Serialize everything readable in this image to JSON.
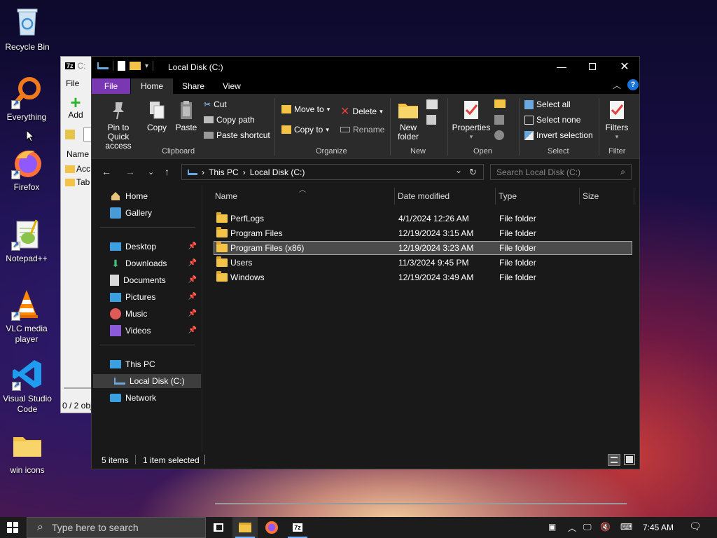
{
  "desktop": {
    "icons": [
      {
        "label": "Recycle Bin"
      },
      {
        "label": "Everything"
      },
      {
        "label": "Firefox"
      },
      {
        "label": "Notepad++"
      },
      {
        "label": "VLC media player"
      },
      {
        "label": "Visual Studio Code"
      },
      {
        "label": "win icons"
      }
    ]
  },
  "bg_window": {
    "title_fragment": "C:",
    "menu_fragment": "File",
    "add_label": "Add",
    "col_name": "Name",
    "rows": [
      "Acc",
      "Tab"
    ],
    "status": "0 / 2 obj"
  },
  "explorer": {
    "title": "Local Disk (C:)",
    "tabs": {
      "file": "File",
      "home": "Home",
      "share": "Share",
      "view": "View"
    },
    "ribbon": {
      "pin_label": "Pin to Quick access",
      "copy_label": "Copy",
      "paste_label": "Paste",
      "cut_label": "Cut",
      "copy_path_label": "Copy path",
      "paste_shortcut_label": "Paste shortcut",
      "clipboard_group": "Clipboard",
      "move_to_label": "Move to",
      "copy_to_label": "Copy to",
      "delete_label": "Delete",
      "rename_label": "Rename",
      "organize_group": "Organize",
      "new_folder_label": "New folder",
      "new_group": "New",
      "properties_label": "Properties",
      "open_group": "Open",
      "select_all_label": "Select all",
      "select_none_label": "Select none",
      "invert_selection_label": "Invert selection",
      "select_group": "Select",
      "filters_label": "Filters",
      "filter_group": "Filter"
    },
    "address": {
      "crumb1": "This PC",
      "crumb2": "Local Disk (C:)",
      "search_placeholder": "Search Local Disk (C:)"
    },
    "nav": {
      "home": "Home",
      "gallery": "Gallery",
      "desktop": "Desktop",
      "downloads": "Downloads",
      "documents": "Documents",
      "pictures": "Pictures",
      "music": "Music",
      "videos": "Videos",
      "this_pc": "This PC",
      "local_disk": "Local Disk (C:)",
      "network": "Network"
    },
    "columns": {
      "name": "Name",
      "date": "Date modified",
      "type": "Type",
      "size": "Size"
    },
    "files": [
      {
        "name": "PerfLogs",
        "date": "4/1/2024 12:26 AM",
        "type": "File folder"
      },
      {
        "name": "Program Files",
        "date": "12/19/2024 3:15 AM",
        "type": "File folder"
      },
      {
        "name": "Program Files (x86)",
        "date": "12/19/2024 3:23 AM",
        "type": "File folder"
      },
      {
        "name": "Users",
        "date": "11/3/2024 9:45 PM",
        "type": "File folder"
      },
      {
        "name": "Windows",
        "date": "12/19/2024 3:49 AM",
        "type": "File folder"
      }
    ],
    "status": {
      "items": "5 items",
      "selected": "1 item selected"
    }
  },
  "taskbar": {
    "search_placeholder": "Type here to search",
    "time": "7:45 AM"
  }
}
